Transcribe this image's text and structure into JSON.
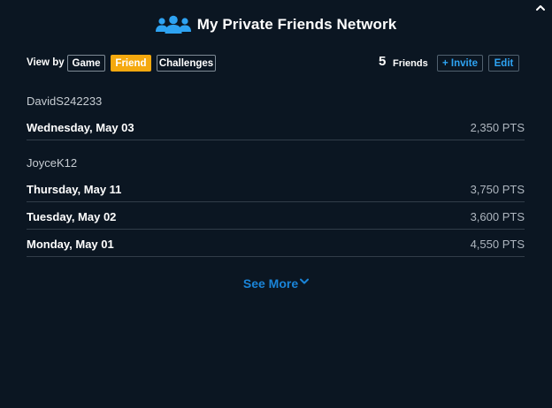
{
  "header": {
    "title": "My Private Friends Network",
    "icon": "people-group-icon"
  },
  "toolbar": {
    "view_by_label": "View by",
    "filters": [
      {
        "label": "Game",
        "active": false
      },
      {
        "label": "Friend",
        "active": true
      },
      {
        "label": "Challenges",
        "active": false
      }
    ],
    "friends_count": "5",
    "friends_label": "Friends",
    "invite_label": "+ Invite",
    "edit_label": "Edit"
  },
  "groups": [
    {
      "user": "DavidS242233",
      "entries": [
        {
          "date": "Wednesday, May 03",
          "points": "2,350 PTS"
        }
      ]
    },
    {
      "user": "JoyceK12",
      "entries": [
        {
          "date": "Thursday, May 11",
          "points": "3,750 PTS"
        },
        {
          "date": "Tuesday, May 02",
          "points": "3,600 PTS"
        },
        {
          "date": "Monday, May 01",
          "points": "4,550 PTS"
        }
      ]
    }
  ],
  "see_more_label": "See More",
  "colors": {
    "background": "#0b1622",
    "accent_orange": "#f5a90f",
    "accent_blue": "#1a84d8",
    "divider": "#313d49"
  }
}
